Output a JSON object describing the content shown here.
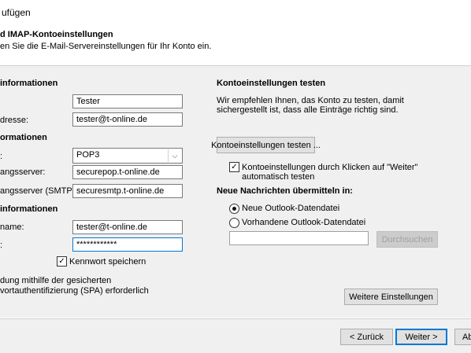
{
  "window": {
    "title": "ufügen"
  },
  "header": {
    "title": "d IMAP-Kontoeinstellungen",
    "subtitle": "en Sie die E-Mail-Servereinstellungen für Ihr Konto ein."
  },
  "left": {
    "user_section": "informationen",
    "name_label": "",
    "name_value": "Tester",
    "email_label": "dresse:",
    "email_value": "tester@t-online.de",
    "server_section": "ormationen",
    "type_label": ":",
    "type_value": "POP3",
    "incoming_label": "angsserver:",
    "incoming_value": "securepop.t-online.de",
    "outgoing_label": "angsserver (SMTP):",
    "outgoing_value": "securesmtp.t-online.de",
    "login_section": "informationen",
    "username_label": "name:",
    "username_value": "tester@t-online.de",
    "password_label": ":",
    "password_value": "************",
    "remember_password": "Kennwort speichern",
    "spa_line1": "dung mithilfe der gesicherten",
    "spa_line2": "vortauthentifizierung (SPA) erforderlich"
  },
  "right": {
    "test_title": "Kontoeinstellungen testen",
    "test_desc_line1": "Wir empfehlen Ihnen, das Konto zu testen, damit",
    "test_desc_line2": "sichergestellt ist, dass alle Einträge richtig sind.",
    "test_button": "Kontoeinstellungen testen ...",
    "auto_test_line1": "Kontoeinstellungen durch Klicken auf \"Weiter\"",
    "auto_test_line2": "automatisch testen",
    "deliver_title": "Neue Nachrichten übermitteln in:",
    "radio_new": "Neue Outlook-Datendatei",
    "radio_existing": "Vorhandene Outlook-Datendatei",
    "file_value": "",
    "browse_button": "Durchsuchen",
    "more_settings_button": "Weitere Einstellungen"
  },
  "footer": {
    "back_button": "< Zurück",
    "next_button": "Weiter >",
    "cancel_button": "Ab"
  },
  "colors": {
    "accent": "#0078d7",
    "panel": "#f0f0f0",
    "disabled_text": "#a0a0a0"
  }
}
